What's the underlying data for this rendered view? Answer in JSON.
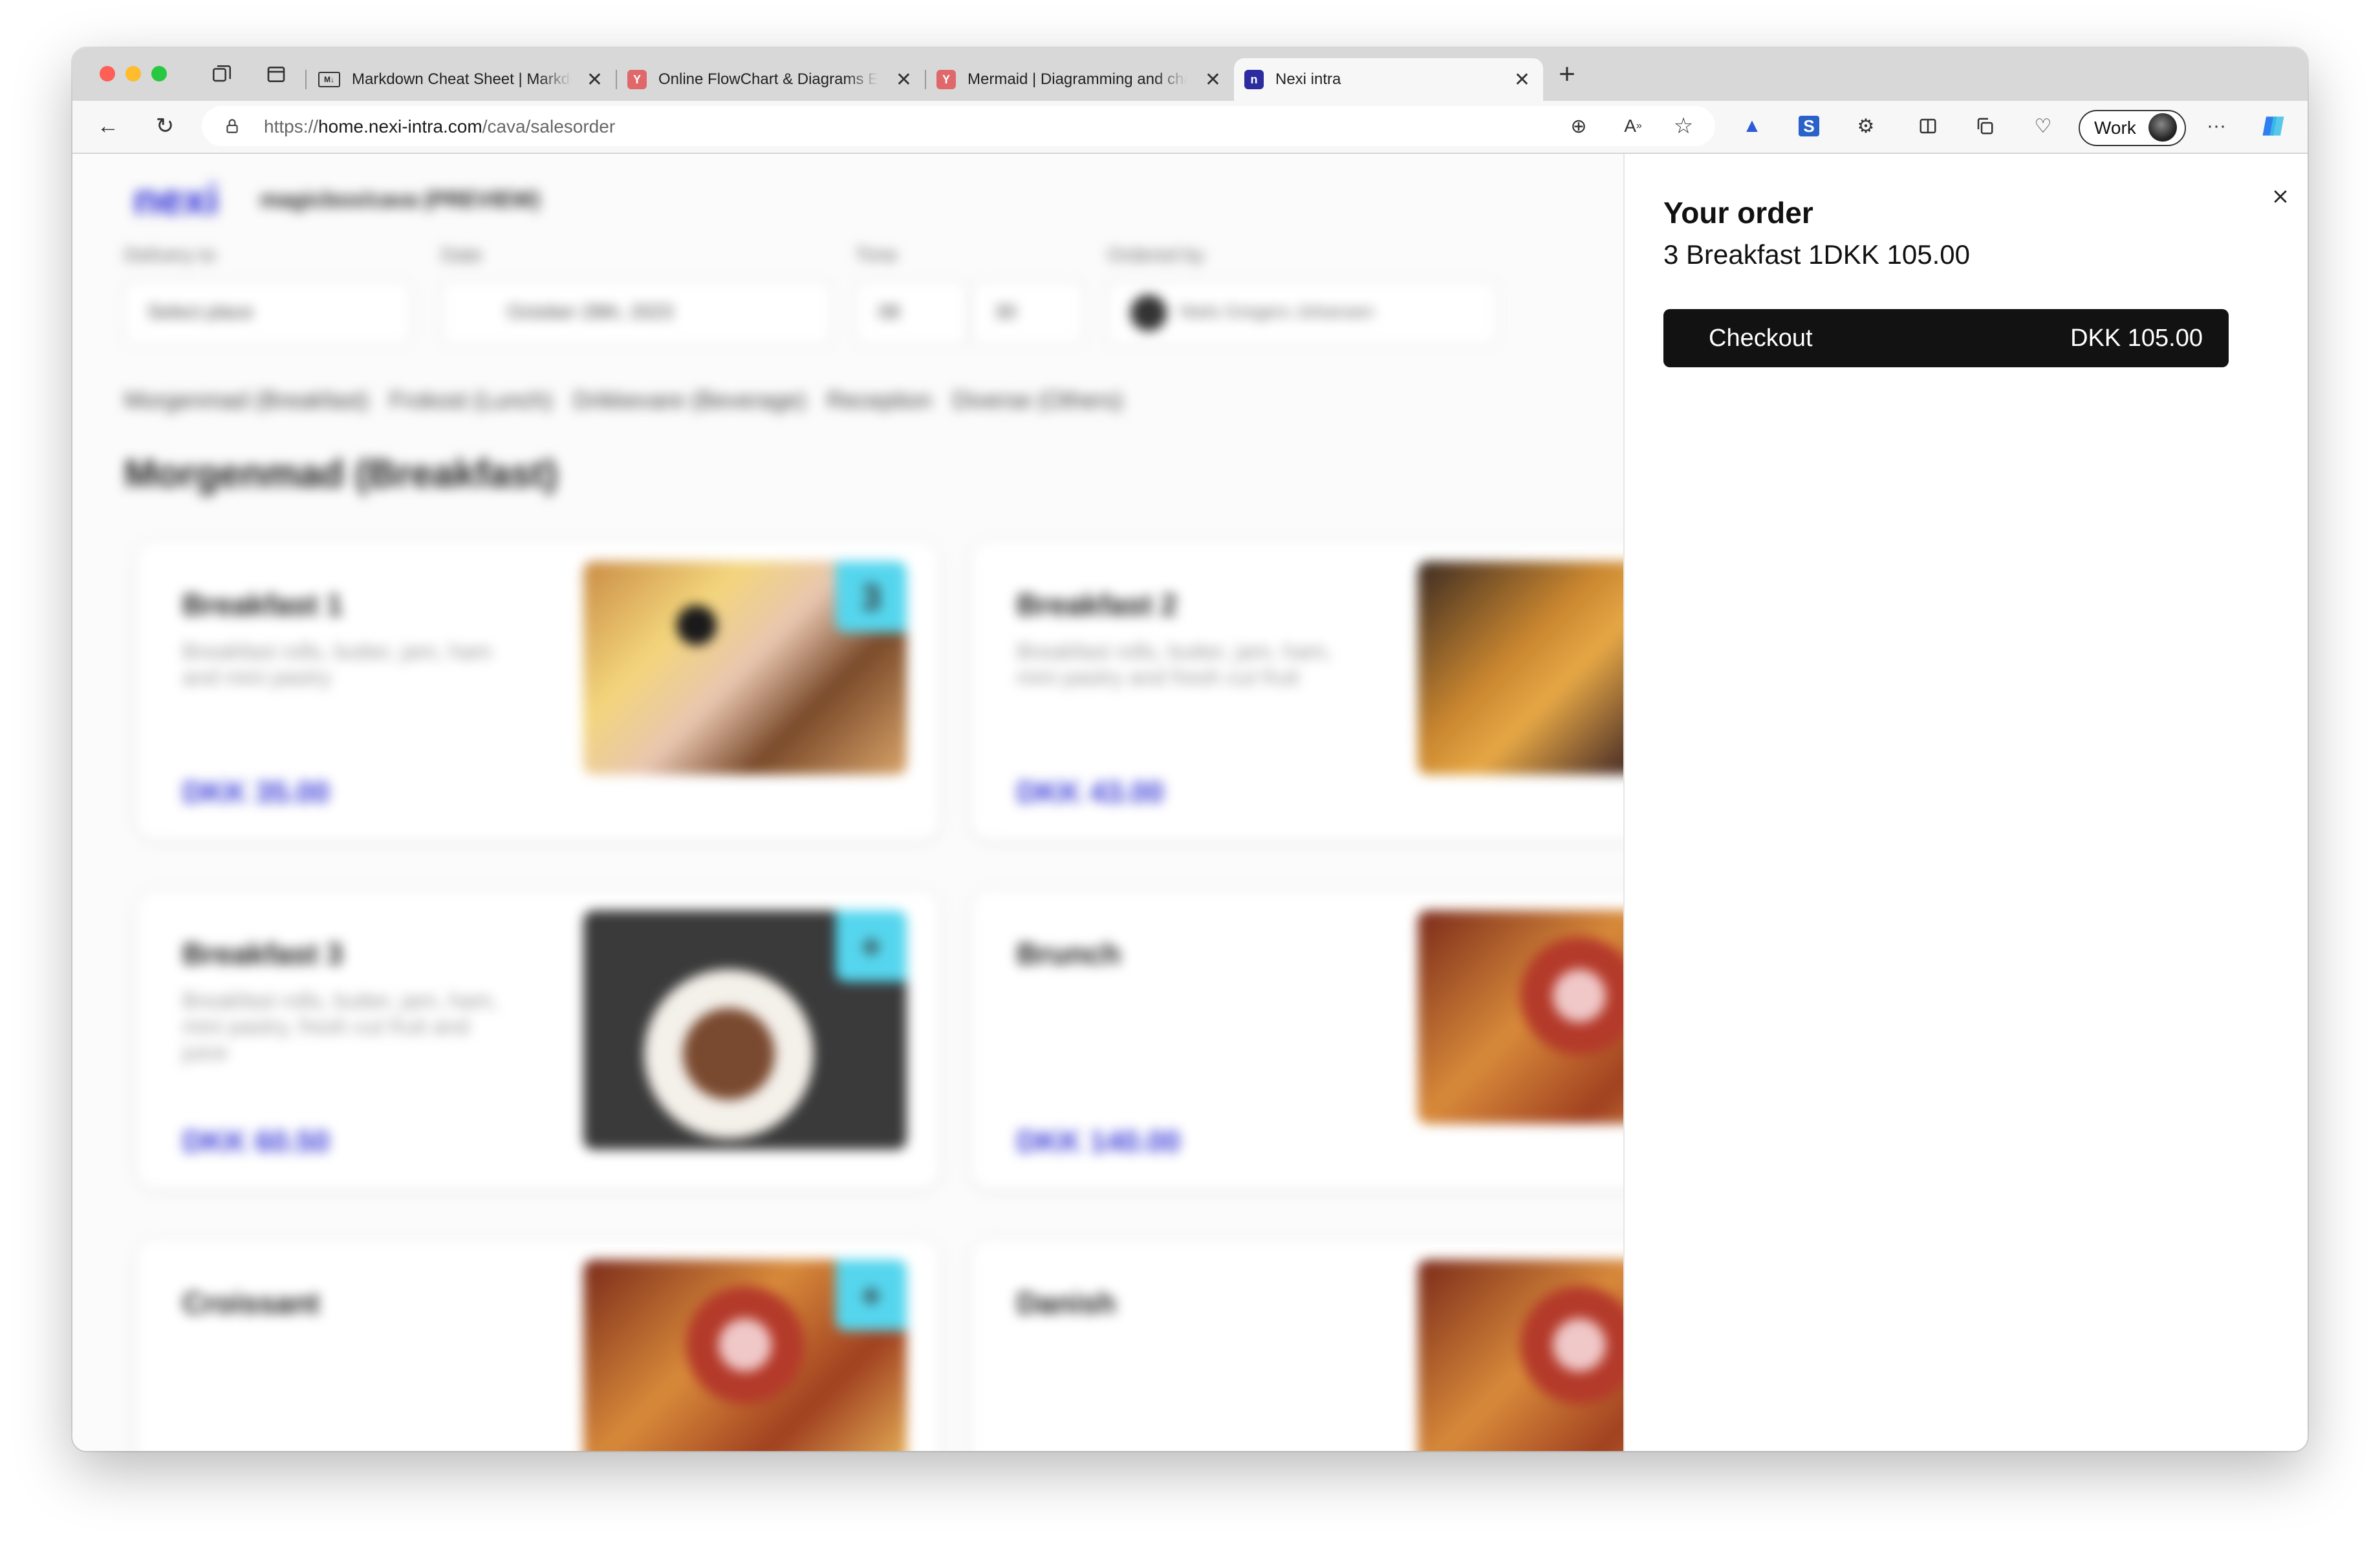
{
  "browser": {
    "tabs": [
      {
        "title": "Markdown Cheat Sheet | Markdown Guide",
        "icon": "markdown-icon",
        "active": false
      },
      {
        "title": "Online FlowChart & Diagrams Editor",
        "icon": "mermaid-icon",
        "active": false
      },
      {
        "title": "Mermaid | Diagramming and charting tool",
        "icon": "mermaid-icon",
        "active": false
      },
      {
        "title": "Nexi intra",
        "icon": "nexi-icon",
        "active": true
      }
    ],
    "new_tab": "+",
    "url_prefix": "https://",
    "url_host": "home.nexi-intra.com",
    "url_path": "/cava/salesorder",
    "profile_label": "Work"
  },
  "page": {
    "logo": "nexi",
    "app_title": "magicbox/cava (PREVIEW)",
    "filters": {
      "delivery_label": "Delivery to",
      "delivery_value": "Select place",
      "date_label": "Date",
      "date_value": "October 28th, 2023",
      "time_label": "Time",
      "time_hour": "08",
      "time_minute": "30",
      "ordered_by_label": "Ordered by",
      "ordered_by_value": "Niels Gregers Johansen"
    },
    "categories": [
      "Morgenmad (Breakfast)",
      "Frokost (Lunch)",
      "Drikkevare (Beverage)",
      "Reception",
      "Diverse (Others)"
    ],
    "section_title": "Morgenmad (Breakfast)",
    "products": [
      {
        "name": "Breakfast 1",
        "description": "Breakfast rolls, butter, jam, ham and mini pastry",
        "price": "DKK 35.00",
        "badge": "3"
      },
      {
        "name": "Breakfast 2",
        "description": "Breakfast rolls, butter, jam, ham, mini pastry and fresh cut fruit",
        "price": "DKK 43.00",
        "badge": ""
      },
      {
        "name": "Breakfast 3",
        "description": "Breakfast rolls, butter, jam, ham, mini pastry, fresh cut fruit and juice",
        "price": "DKK 60.50",
        "badge": "+"
      },
      {
        "name": "Brunch",
        "description": "",
        "price": "DKK 140.00",
        "badge": ""
      },
      {
        "name": "Croissant",
        "description": "",
        "price": "",
        "badge": "+"
      },
      {
        "name": "Danish",
        "description": "",
        "price": "",
        "badge": ""
      }
    ]
  },
  "order": {
    "title": "Your order",
    "line": "3 Breakfast 1DKK 105.00",
    "checkout_label": "Checkout",
    "checkout_total": "DKK 105.00",
    "close_icon": "close-icon"
  },
  "colors": {
    "accent": "#3b3bd8",
    "badge": "#55d6ee",
    "checkout_bg": "#121212"
  }
}
